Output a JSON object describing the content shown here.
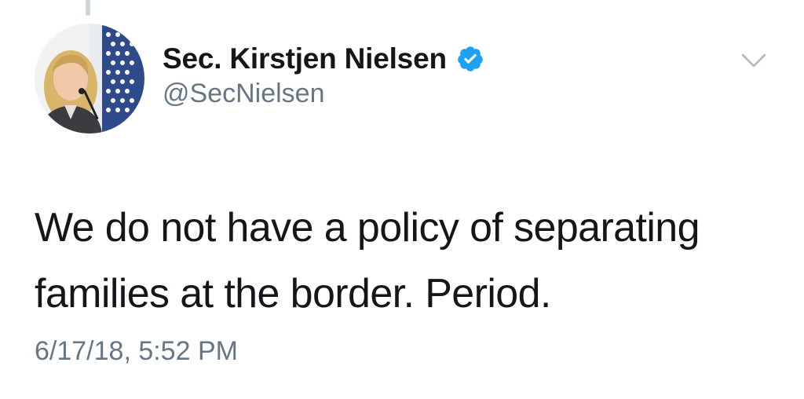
{
  "tweet": {
    "author": {
      "display_name": "Sec. Kirstjen Nielsen",
      "handle": "@SecNielsen",
      "verified": true,
      "avatar_icon": "profile-photo"
    },
    "text": "We do not have a policy of separating\nfamilies at the border.  Period.",
    "timestamp": "6/17/18, 5:52 PM",
    "menu_icon": "chevron-down-icon"
  },
  "colors": {
    "text_primary": "#14171a",
    "text_secondary": "#657786",
    "verified_blue": "#1da1f2",
    "chevron": "#aab8c2",
    "thread_line": "#ccd6dd"
  }
}
